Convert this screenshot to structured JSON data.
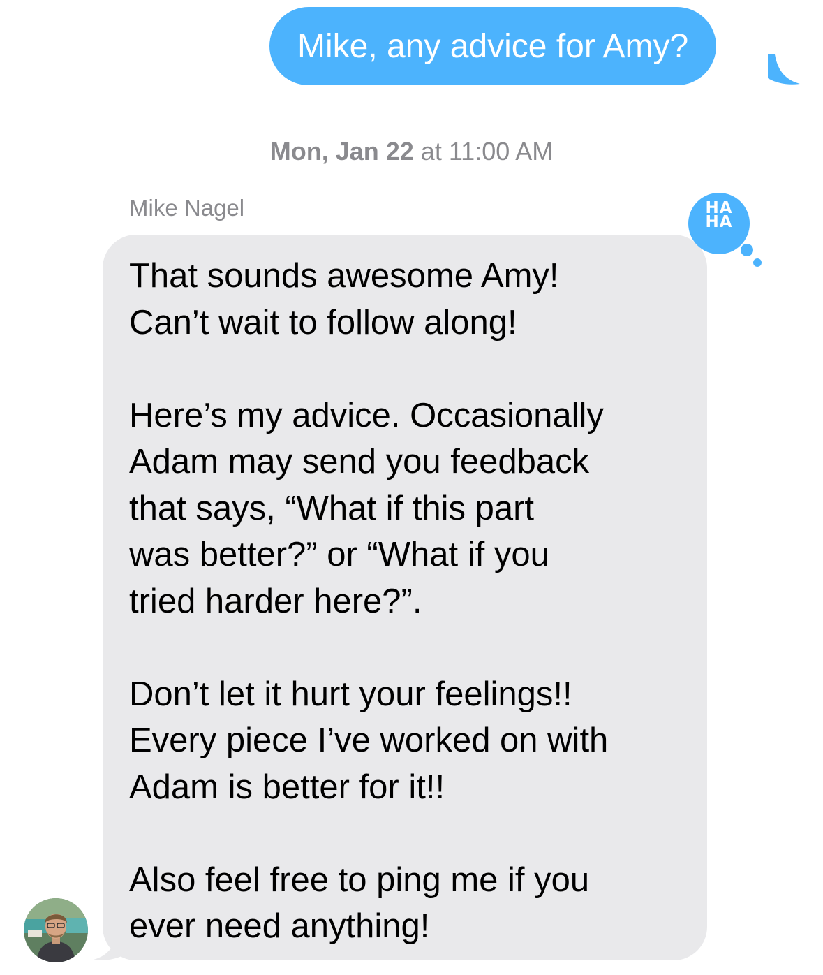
{
  "outgoing": {
    "text": "Mike, any advice for Amy?"
  },
  "timestamp": {
    "day": "Mon, Jan 22",
    "time": "at 11:00 AM"
  },
  "incoming": {
    "sender": "Mike Nagel",
    "lines": [
      "That sounds awesome Amy!",
      "Can’t wait to follow along!",
      "",
      "Here’s my advice. Occasionally",
      "Adam may send you feedback",
      "that says, “What if this part",
      "was better?” or “What if you",
      "tried harder here?”.",
      "",
      "Don’t let it hurt your feelings!!",
      "Every piece I’ve worked on with",
      "Adam is better for it!!",
      "",
      "Also feel free to ping me if you",
      "ever need anything!"
    ]
  },
  "tapback": {
    "line1": "HA",
    "line2": "HA",
    "icon": "haha-reaction-icon"
  },
  "colors": {
    "outgoing_bubble": "#4cb3fd",
    "incoming_bubble": "#e9e9eb",
    "meta_text": "#8a8a8e"
  }
}
